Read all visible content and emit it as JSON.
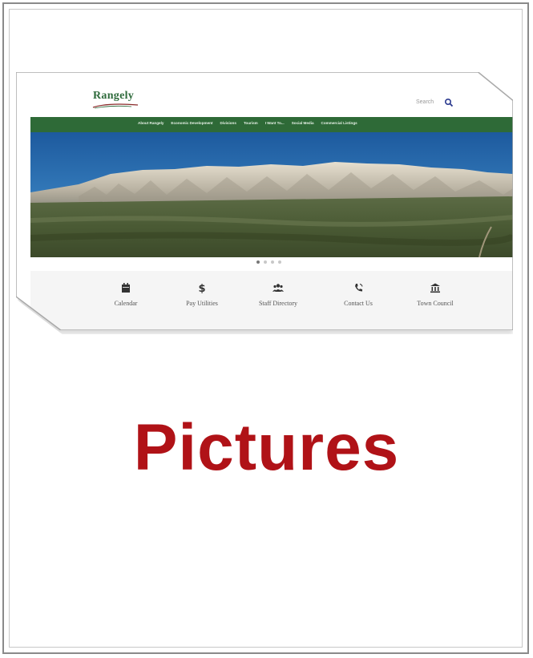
{
  "website": {
    "logo_text": "Rangely",
    "search_label": "Search",
    "nav_items": [
      "About Rangely",
      "Economic Development",
      "Divisions",
      "Tourism",
      "I Want To...",
      "Social Media",
      "Commercial Listings"
    ],
    "slider": {
      "slide_count": 4,
      "active_slide": 1
    },
    "quick_links": [
      {
        "label": "Calendar",
        "icon": "calendar-icon"
      },
      {
        "label": "Pay Utilities",
        "icon": "dollar-icon"
      },
      {
        "label": "Staff Directory",
        "icon": "users-icon"
      },
      {
        "label": "Contact Us",
        "icon": "phone-icon"
      },
      {
        "label": "Town Council",
        "icon": "building-icon"
      }
    ]
  },
  "heading": "Pictures",
  "colors": {
    "nav_green": "#2e6a37",
    "heading_red": "#b01217",
    "logo_green": "#2f6b3c"
  }
}
